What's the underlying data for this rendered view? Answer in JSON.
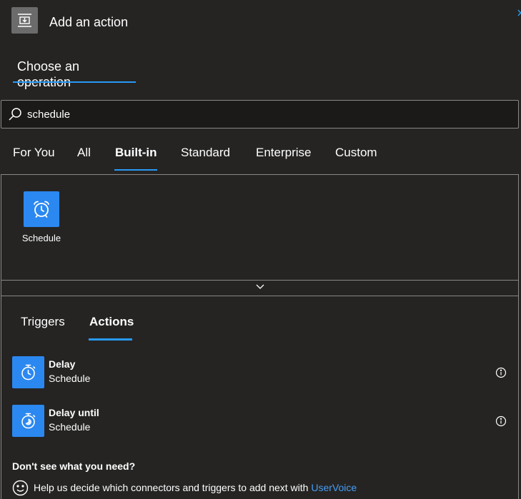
{
  "header": {
    "title": "Add an action",
    "icon": "insert-step-icon"
  },
  "choose_tab": {
    "label": "Choose an operation"
  },
  "search": {
    "value": "schedule",
    "placeholder": "",
    "icon": "search-icon"
  },
  "filter_tabs": [
    {
      "label": "For You",
      "active": false
    },
    {
      "label": "All",
      "active": false
    },
    {
      "label": "Built-in",
      "active": true
    },
    {
      "label": "Standard",
      "active": false
    },
    {
      "label": "Enterprise",
      "active": false
    },
    {
      "label": "Custom",
      "active": false
    }
  ],
  "connectors": [
    {
      "label": "Schedule",
      "icon": "alarm-clock-icon"
    }
  ],
  "sub_tabs": [
    {
      "label": "Triggers",
      "active": false
    },
    {
      "label": "Actions",
      "active": true
    }
  ],
  "actions": [
    {
      "name": "Delay",
      "connector": "Schedule",
      "icon": "timer-icon"
    },
    {
      "name": "Delay until",
      "connector": "Schedule",
      "icon": "timer-until-icon"
    }
  ],
  "help": {
    "heading": "Don't see what you need?",
    "text": "Help us decide which connectors and triggers to add next with ",
    "link": "UserVoice"
  },
  "colors": {
    "accent": "#2899f5",
    "tile": "#2b88f0",
    "background": "#252423",
    "link": "#479ef5"
  }
}
